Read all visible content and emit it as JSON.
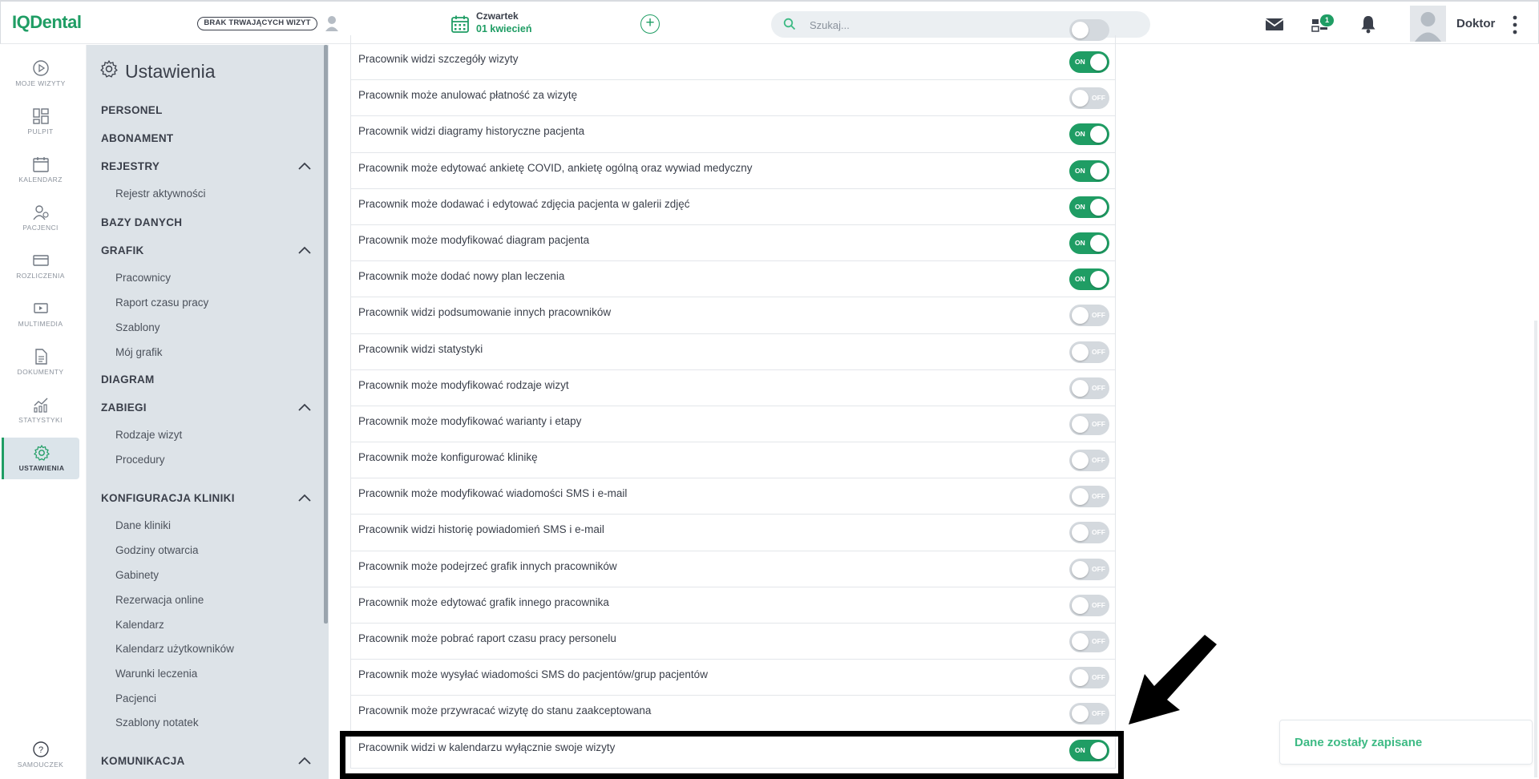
{
  "header": {
    "logo": "IQDental",
    "visits_button": "BRAK TRWAJĄCYCH WIZYT",
    "date_day": "Czwartek",
    "date_value": "01 kwiecień",
    "search_placeholder": "Szukaj...",
    "tasks_badge": "1",
    "user_name": "Doktor"
  },
  "rail": [
    {
      "label": "MOJE WIZYTY",
      "icon": "play-circle-icon"
    },
    {
      "label": "PULPIT",
      "icon": "dashboard-icon"
    },
    {
      "label": "KALENDARZ",
      "icon": "calendar-icon"
    },
    {
      "label": "PACJENCI",
      "icon": "patients-icon"
    },
    {
      "label": "ROZLICZENIA",
      "icon": "card-icon"
    },
    {
      "label": "MULTIMEDIA",
      "icon": "media-icon"
    },
    {
      "label": "DOKUMENTY",
      "icon": "document-icon"
    },
    {
      "label": "STATYSTYKI",
      "icon": "stats-icon"
    },
    {
      "label": "USTAWIENIA",
      "icon": "gear-icon",
      "active": true
    },
    {
      "label": "SAMOUCZEK",
      "icon": "help-icon"
    }
  ],
  "panel": {
    "title": "Ustawienia",
    "sections": {
      "personel": "PERSONEL",
      "abonament": "ABONAMENT",
      "rejestry": "REJESTRY",
      "rejestry_items": [
        "Rejestr aktywności"
      ],
      "bazy": "BAZY DANYCH",
      "grafik": "GRAFIK",
      "grafik_items": [
        "Pracownicy",
        "Raport czasu pracy",
        "Szablony",
        "Mój grafik"
      ],
      "diagram": "DIAGRAM",
      "zabiegi": "ZABIEGI",
      "zabiegi_items": [
        "Rodzaje wizyt",
        "Procedury"
      ],
      "konfig": "KONFIGURACJA KLINIKI",
      "konfig_items": [
        "Dane kliniki",
        "Godziny otwarcia",
        "Gabinety",
        "Rezerwacja online",
        "Kalendarz",
        "Kalendarz użytkowników",
        "Warunki leczenia",
        "Pacjenci",
        "Szablony notatek"
      ],
      "komunikacja": "KOMUNIKACJA"
    }
  },
  "toggle_labels": {
    "on": "ON",
    "off": "OFF"
  },
  "permissions": [
    {
      "label": "Pracownik widzi szczegóły wizyty",
      "on": true
    },
    {
      "label": "Pracownik może anulować płatność za wizytę",
      "on": false
    },
    {
      "label": "Pracownik widzi diagramy historyczne pacjenta",
      "on": true
    },
    {
      "label": "Pracownik może edytować ankietę COVID, ankietę ogólną oraz wywiad medyczny",
      "on": true
    },
    {
      "label": "Pracownik może dodawać i edytować zdjęcia pacjenta w galerii zdjęć",
      "on": true
    },
    {
      "label": "Pracownik może modyfikować diagram pacjenta",
      "on": true
    },
    {
      "label": "Pracownik może dodać nowy plan leczenia",
      "on": true
    },
    {
      "label": "Pracownik widzi podsumowanie innych pracowników",
      "on": false
    },
    {
      "label": "Pracownik widzi statystyki",
      "on": false
    },
    {
      "label": "Pracownik może modyfikować rodzaje wizyt",
      "on": false
    },
    {
      "label": "Pracownik może modyfikować warianty i etapy",
      "on": false
    },
    {
      "label": "Pracownik może konfigurować klinikę",
      "on": false
    },
    {
      "label": "Pracownik może modyfikować wiadomości SMS i e-mail",
      "on": false
    },
    {
      "label": "Pracownik widzi historię powiadomień SMS i e-mail",
      "on": false
    },
    {
      "label": "Pracownik może podejrzeć grafik innych pracowników",
      "on": false
    },
    {
      "label": "Pracownik może edytować grafik innego pracownika",
      "on": false
    },
    {
      "label": "Pracownik może pobrać raport czasu pracy personelu",
      "on": false
    },
    {
      "label": "Pracownik może wysyłać wiadomości SMS do pacjentów/grup pacjentów",
      "on": false
    },
    {
      "label": "Pracownik może przywracać wizytę do stanu zaakceptowana",
      "on": false
    },
    {
      "label": "Pracownik widzi w kalendarzu wyłącznie swoje wizyty",
      "on": true
    }
  ],
  "toast": "Dane zostały zapisane",
  "colors": {
    "accent": "#1f9d64",
    "panel_bg": "#dde3e8",
    "toggle_off": "#d4d9de"
  }
}
